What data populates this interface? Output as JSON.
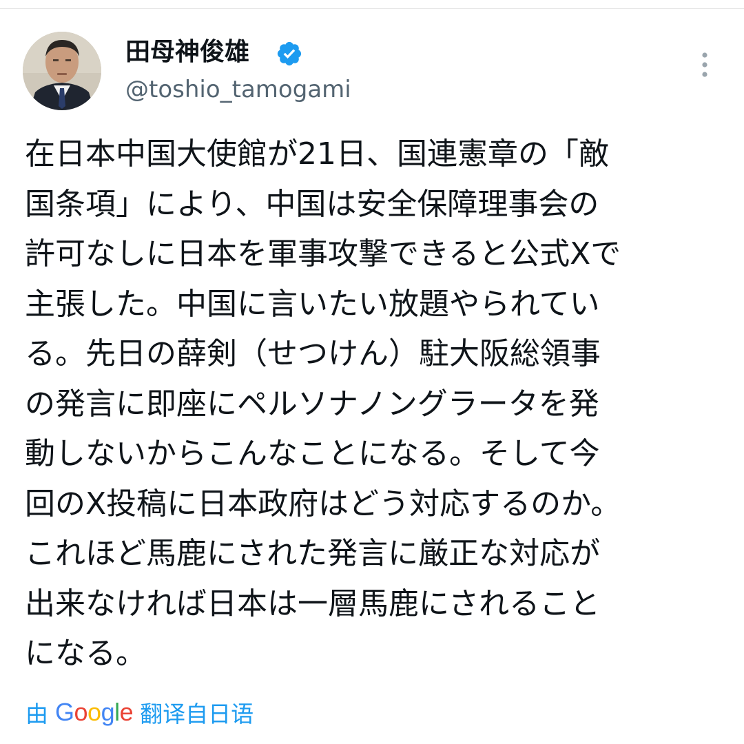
{
  "author": {
    "display_name": "田母神俊雄",
    "handle": "@toshio_tamogami",
    "verified_icon": "verified-badge-icon",
    "avatar": "avatar-photo"
  },
  "tweet": {
    "lines": [
      "在日本中国大使館が21日、国連憲章の「敵",
      "国条項」により、中国は安全保障理事会の",
      "許可なしに日本を軍事攻撃できると公式Xで",
      "主張した。中国に言いたい放題やられてい",
      "る。先日の薛剣（せつけん）駐大阪総領事",
      "の発言に即座にペルソナノングラータを発",
      "動しないからこんなことになる。そして今",
      "回のX投稿に日本政府はどう対応するのか。",
      "これほど馬鹿にされた発言に厳正な対応が",
      "出来なければ日本は一層馬鹿にされること",
      "になる。"
    ]
  },
  "translate_bar": {
    "prefix": "由",
    "brand": [
      "G",
      "o",
      "o",
      "g",
      "l",
      "e"
    ],
    "suffix": "翻译自日语"
  },
  "colors": {
    "link_blue": "#1d9bf0",
    "verified_blue": "#1d9bf0",
    "secondary_text": "#536471"
  },
  "icons": [
    "verified-badge-icon",
    "more-options-icon"
  ]
}
